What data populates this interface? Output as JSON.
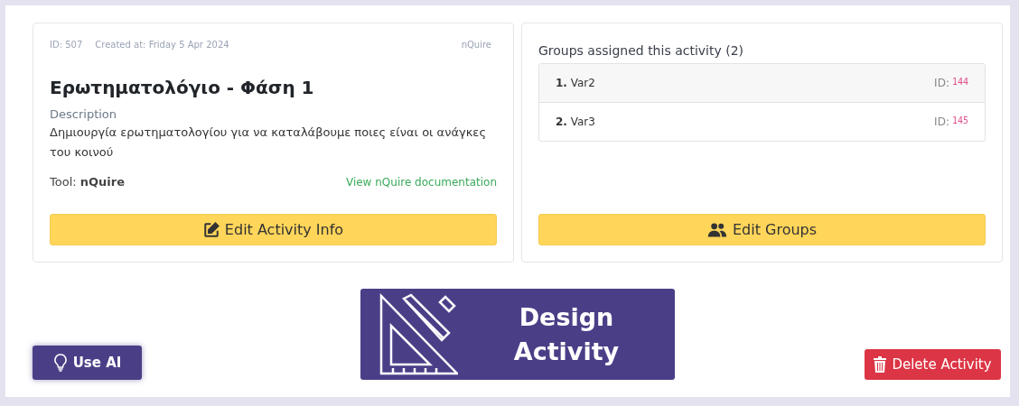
{
  "activity": {
    "id": "ID: 507",
    "created": "Created at: Friday 5 Apr 2024",
    "tool_tag": "nQuire",
    "title": "Ερωτηματολόγιο - Φάση 1",
    "description_label": "Description",
    "description": "Δημιουργία ερωτηματολογίου για να καταλάβουμε ποιες είναι οι ανάγκες του κοινού",
    "tool": "Tool: **nQuire**",
    "doc_link": "View nQuire documentation",
    "edit_button": "Edit Activity Info"
  },
  "groups": {
    "title": "Groups assigned this activity (2)",
    "items": [
      {
        "name": "**1.** Var2",
        "id_label": "ID:",
        "id": "144"
      },
      {
        "name": "**2.** Var3",
        "id_label": "ID:",
        "id": "145"
      }
    ],
    "edit_button": "Edit Groups"
  },
  "footer": {
    "use_ai": "Use AI",
    "design": [
      "Design",
      "Activity"
    ],
    "delete": "Delete Activity"
  }
}
